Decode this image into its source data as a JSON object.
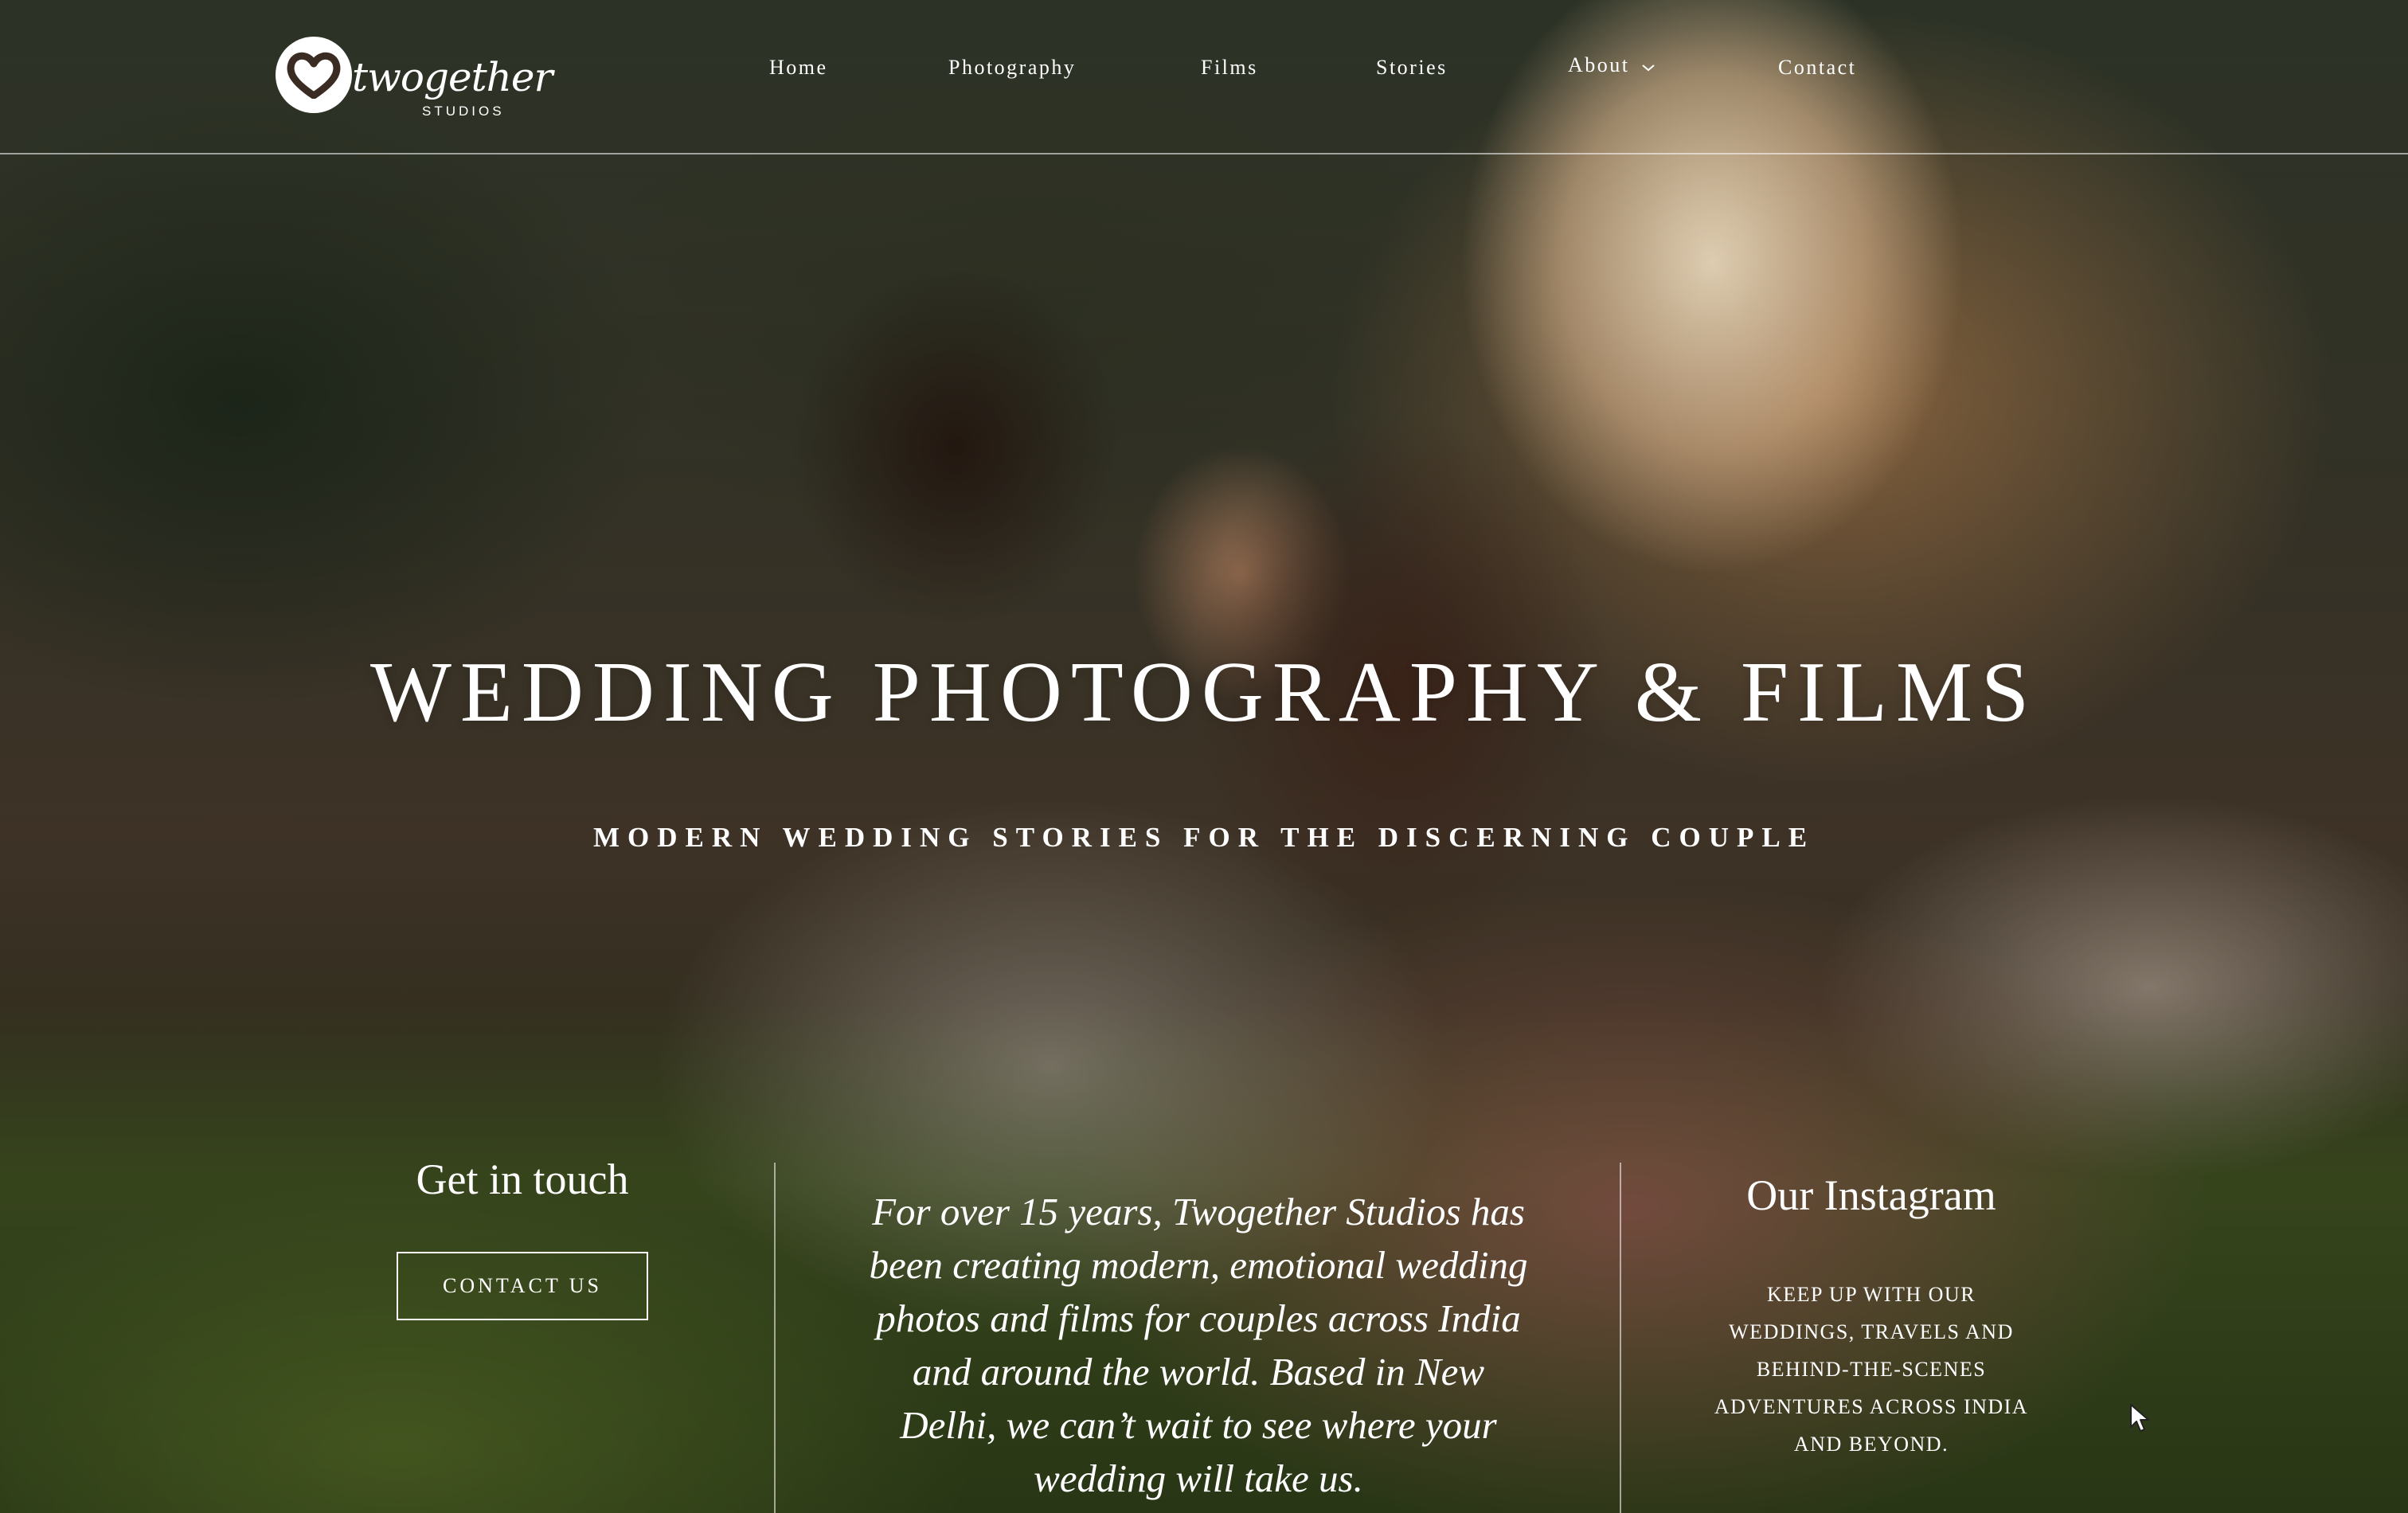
{
  "brand": {
    "logo_word": "twogether",
    "logo_sub": "STUDIOS"
  },
  "nav": {
    "home": "Home",
    "photography": "Photography",
    "films": "Films",
    "stories": "Stories",
    "about": "About",
    "contact": "Contact"
  },
  "hero": {
    "title": "WEDDING PHOTOGRAPHY & FILMS",
    "subtitle": "MODERN WEDDING STORIES FOR THE DISCERNING COUPLE"
  },
  "get_in_touch": {
    "heading": "Get in touch",
    "button_label": "CONTACT US"
  },
  "intro": {
    "lines": [
      "For over 15 years, Twogether Studios has",
      "been creating modern, emotional wedding",
      "photos and films for couples across India",
      "and around the world. Based in New",
      "Delhi, we can’t wait to see where your",
      "wedding will take us."
    ]
  },
  "instagram": {
    "heading": "Our Instagram",
    "lines": [
      "KEEP UP WITH OUR",
      "WEDDINGS, TRAVELS AND",
      "BEHIND-THE-SCENES",
      "ADVENTURES ACROSS INDIA",
      "AND BEYOND."
    ]
  },
  "colors": {
    "text": "#ffffff",
    "divider": "#ffffff"
  },
  "icons": {
    "logo": "heart-logo-icon",
    "dropdown": "chevron-down-icon",
    "cursor": "mouse-cursor-icon"
  }
}
